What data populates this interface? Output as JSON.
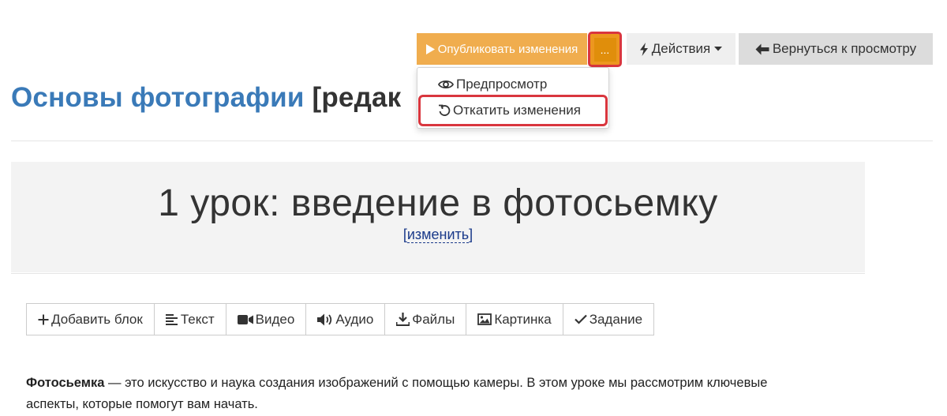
{
  "toolbar": {
    "publish_label": "Опубликовать изменения",
    "more_label": "...",
    "actions_label": "Действия",
    "back_label": "Вернуться к просмотру"
  },
  "dropdown": {
    "items": [
      {
        "label": "Предпросмотр",
        "icon": "eye-icon"
      },
      {
        "label": "Откатить изменения",
        "icon": "undo-icon"
      }
    ]
  },
  "page": {
    "title": "Основы фотографии",
    "edit_tag": "[редак"
  },
  "lesson": {
    "title": "1 урок: введение в фотосьемку",
    "edit_open": "[",
    "edit_link": "изменить",
    "edit_close": "]"
  },
  "blocks": [
    {
      "label": "Добавить блок",
      "icon": "plus-icon"
    },
    {
      "label": "Текст",
      "icon": "align-left-icon"
    },
    {
      "label": "Видео",
      "icon": "video-camera-icon"
    },
    {
      "label": "Аудио",
      "icon": "volume-icon"
    },
    {
      "label": "Файлы",
      "icon": "download-icon"
    },
    {
      "label": "Картинка",
      "icon": "image-icon"
    },
    {
      "label": "Задание",
      "icon": "check-icon"
    }
  ],
  "content": {
    "term": "Фотосьемка",
    "text": " — это искусство и наука создания изображений с помощью камеры. В этом уроке мы рассмотрим ключевые аспекты, которые помогут вам начать."
  },
  "colors": {
    "publish": "#f0ad4e",
    "more": "#e08e0b",
    "highlight": "#d9363e",
    "title": "#3a7ab8"
  }
}
